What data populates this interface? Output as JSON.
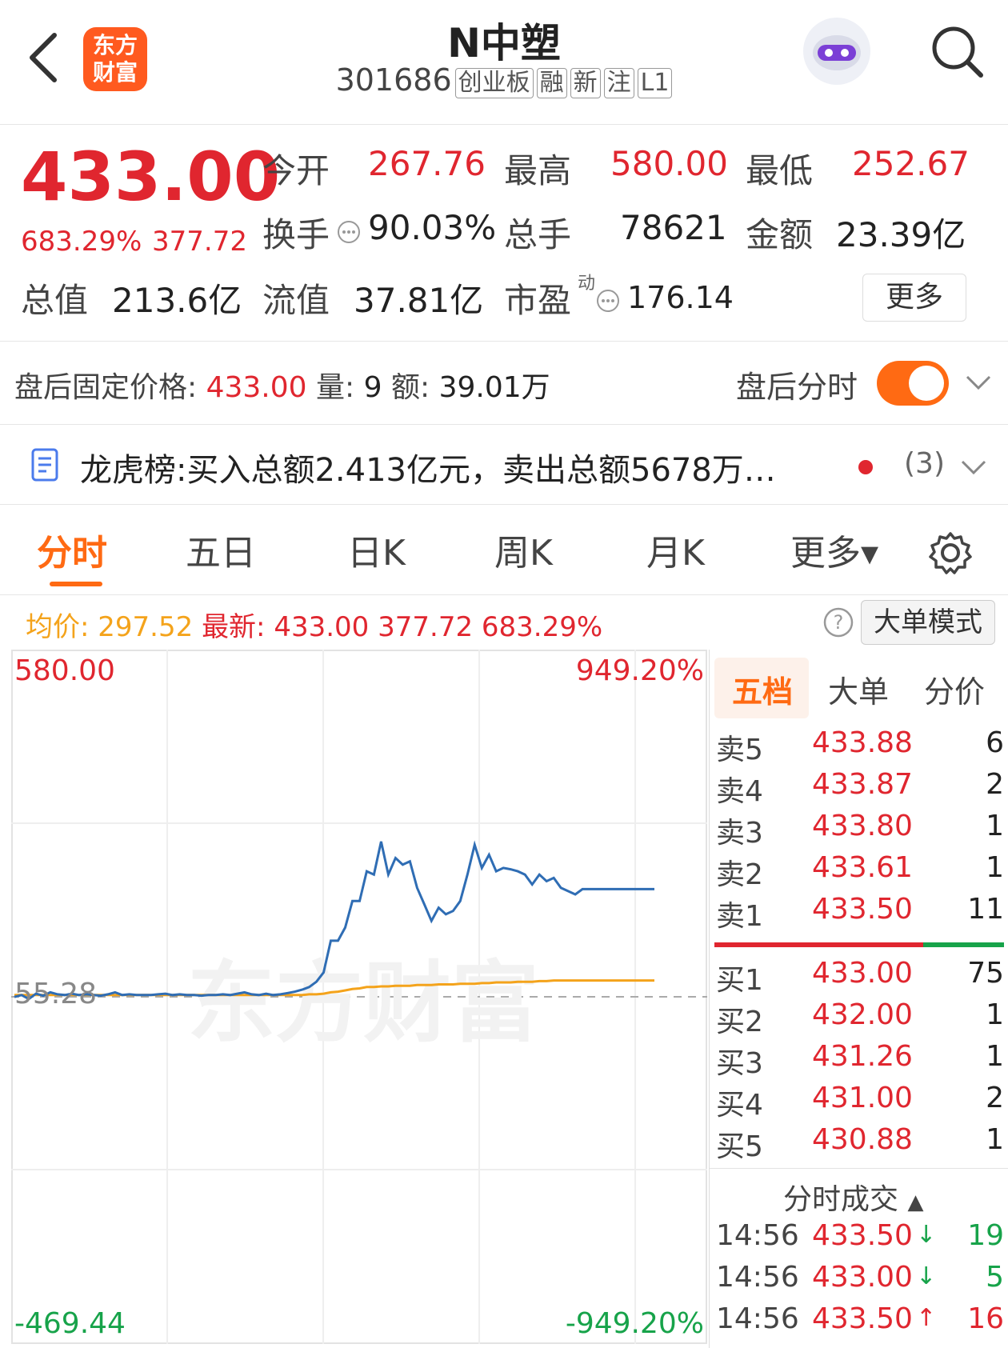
{
  "header": {
    "title": "N中塑",
    "code": "301686",
    "tags": [
      "创业板",
      "融",
      "新",
      "注",
      "L1"
    ],
    "logo_text": [
      "东方",
      "财富"
    ]
  },
  "quote": {
    "price": "433.00",
    "change_pct": "683.29%",
    "change": "377.72",
    "open_label": "今开",
    "open": "267.76",
    "high_label": "最高",
    "high": "580.00",
    "low_label": "最低",
    "low": "252.67",
    "turnover_label": "换手",
    "turnover": "90.03%",
    "volume_label": "总手",
    "volume": "78621",
    "amount_label": "金额",
    "amount": "23.39亿",
    "mktcap_label": "总值",
    "mktcap": "213.6亿",
    "float_label": "流值",
    "float": "37.81亿",
    "pe_label": "市盈",
    "pe_sup": "动",
    "pe": "176.14",
    "more": "更多"
  },
  "after_hours": {
    "label": "盘后固定价格:",
    "price": "433.00",
    "vol_label": "量:",
    "vol": "9",
    "amt_label": "额:",
    "amt": "39.01万",
    "toggle_label": "盘后分时",
    "toggle_on": true
  },
  "dragon": {
    "label": "龙虎榜:",
    "text": "买入总额2.413亿元，卖出总额5678万…",
    "count": "(3)"
  },
  "tabs": [
    "分时",
    "五日",
    "日K",
    "周K",
    "月K",
    "更多▾"
  ],
  "active_tab": 0,
  "avg_line": {
    "avg_label": "均价:",
    "avg": "297.52",
    "latest_label": "最新:",
    "latest": "433.00",
    "change": "377.72",
    "pct": "683.29%",
    "mode_button": "大单模式"
  },
  "chart_data": {
    "type": "line",
    "y_top": "580.00",
    "y_mid": "55.28",
    "y_bottom": "-469.44",
    "pct_top": "949.20%",
    "pct_bottom": "-949.20%",
    "watermark": "东方财富",
    "ylim": [
      -469.44,
      580.0
    ],
    "price": [
      55,
      58,
      52,
      60,
      57,
      62,
      59,
      58,
      60,
      58,
      59,
      58,
      57,
      59,
      62,
      58,
      59,
      58,
      58,
      58,
      59,
      60,
      58,
      59,
      58,
      58,
      57,
      58,
      58,
      59,
      58,
      60,
      62,
      59,
      58,
      60,
      58,
      59,
      61,
      63,
      66,
      70,
      78,
      92,
      140,
      140,
      160,
      200,
      200,
      245,
      240,
      290,
      240,
      265,
      255,
      260,
      220,
      195,
      170,
      190,
      180,
      185,
      200,
      240,
      285,
      250,
      270,
      245,
      250,
      248,
      245,
      240,
      225,
      240,
      230,
      235,
      220,
      215,
      210,
      218,
      218,
      218,
      218,
      218,
      218,
      218,
      218,
      218,
      218,
      218
    ],
    "avg": [
      58,
      58,
      58,
      58,
      58,
      58,
      58,
      58,
      58,
      58,
      58,
      58,
      58,
      58,
      58,
      58,
      58,
      58,
      58,
      58,
      58,
      58,
      58,
      58,
      58,
      58,
      58,
      58,
      58,
      58,
      58,
      58,
      58,
      58,
      58,
      58,
      58,
      58,
      58,
      58,
      58,
      59,
      59,
      60,
      62,
      63,
      65,
      67,
      68,
      70,
      70,
      71,
      71,
      72,
      72,
      72,
      73,
      73,
      73,
      74,
      74,
      74,
      75,
      75,
      75,
      76,
      76,
      77,
      77,
      77,
      78,
      78,
      78,
      79,
      79,
      80,
      80,
      80,
      80,
      80,
      80,
      80,
      80,
      80,
      80,
      80,
      80,
      80,
      80,
      80
    ]
  },
  "order_book": {
    "tabs": [
      "五档",
      "大单",
      "分价"
    ],
    "asks": [
      {
        "label": "卖5",
        "price": "433.88",
        "vol": "6"
      },
      {
        "label": "卖4",
        "price": "433.87",
        "vol": "2"
      },
      {
        "label": "卖3",
        "price": "433.80",
        "vol": "1"
      },
      {
        "label": "卖2",
        "price": "433.61",
        "vol": "1"
      },
      {
        "label": "卖1",
        "price": "433.50",
        "vol": "11"
      }
    ],
    "bids": [
      {
        "label": "买1",
        "price": "433.00",
        "vol": "75"
      },
      {
        "label": "买2",
        "price": "432.00",
        "vol": "1"
      },
      {
        "label": "买3",
        "price": "431.26",
        "vol": "1"
      },
      {
        "label": "买4",
        "price": "431.00",
        "vol": "2"
      },
      {
        "label": "买5",
        "price": "430.88",
        "vol": "1"
      }
    ],
    "trades_title": "分时成交",
    "trades": [
      {
        "time": "14:56",
        "price": "433.50",
        "dir": "↓",
        "vol": "19"
      },
      {
        "time": "14:56",
        "price": "433.00",
        "dir": "↓",
        "vol": "5"
      },
      {
        "time": "14:56",
        "price": "433.50",
        "dir": "↑",
        "vol": "16"
      }
    ],
    "ratio_sell": 0.72
  },
  "colors": {
    "up": "#e0262f",
    "down": "#17a34a",
    "accent": "#ff6a13",
    "price_line": "#2f6db4",
    "avg_line": "#f4a31b"
  }
}
